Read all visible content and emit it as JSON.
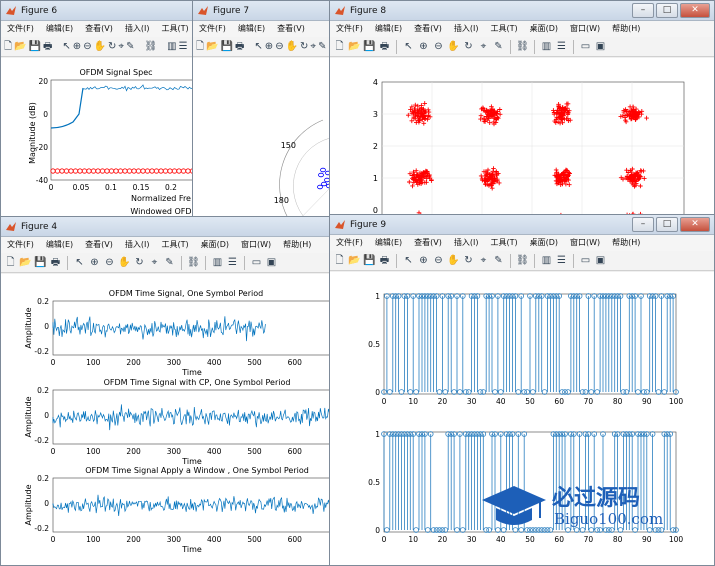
{
  "menu": [
    "文件(F)",
    "编辑(E)",
    "查看(V)",
    "插入(I)",
    "工具(T)",
    "桌面(D)",
    "窗口(W)",
    "帮助(H)"
  ],
  "win_buttons": {
    "min": "–",
    "max": "□",
    "close": "✕"
  },
  "toolbar_icons": [
    "new-file-icon",
    "open-folder-icon",
    "save-icon",
    "print-icon",
    "cursor-icon",
    "zoom-in-icon",
    "zoom-out-icon",
    "pan-icon",
    "rotate-icon",
    "data-cursor-icon",
    "brush-icon",
    "link-icon",
    "colorbar-icon",
    "legend-icon",
    "hide-plot-icon",
    "show-plot-icon"
  ],
  "fig6": {
    "title": "Figure 6",
    "plot_title": "OFDM Signal Spec",
    "ylabel": "Magnitude (dB)",
    "xlabel": "Normalized Fre",
    "sublabel": "Windowed OFD",
    "yticks": [
      "20",
      "0",
      "-20",
      "-40"
    ],
    "xticks": [
      "0",
      "0.05",
      "0.1",
      "0.15",
      "0.2"
    ]
  },
  "fig7": {
    "title": "Figure 7",
    "ticks": [
      "150",
      "180"
    ]
  },
  "fig8": {
    "title": "Figure 8",
    "yticks": [
      "4",
      "3",
      "2",
      "1",
      "0"
    ]
  },
  "fig4": {
    "title": "Figure 4",
    "plot1_title": "OFDM Time Signal, One Symbol Period",
    "plot2_title": "OFDM Time Signal with CP, One Symbol Period",
    "plot3_title": "OFDM Time Signal Apply a Window , One Symbol Period",
    "ylabel": "Amplitude",
    "xlabel": "Time",
    "yticks": [
      "0.2",
      "0",
      "-0.2"
    ],
    "xticks": [
      "0",
      "100",
      "200",
      "300",
      "400",
      "500",
      "600"
    ]
  },
  "fig9": {
    "title": "Figure 9",
    "yticks": [
      "1",
      "0.5",
      "0"
    ],
    "xticks": [
      "0",
      "10",
      "20",
      "30",
      "40",
      "50",
      "60",
      "70",
      "80",
      "90",
      "100"
    ]
  },
  "watermark": {
    "brand": "必过源码",
    "url": "Biguo100.com"
  },
  "colors": {
    "signal": "#0072bd",
    "marker_red": "#ff0000",
    "stem": "#2a7fc0",
    "constellation_blue": "#0000ff"
  }
}
